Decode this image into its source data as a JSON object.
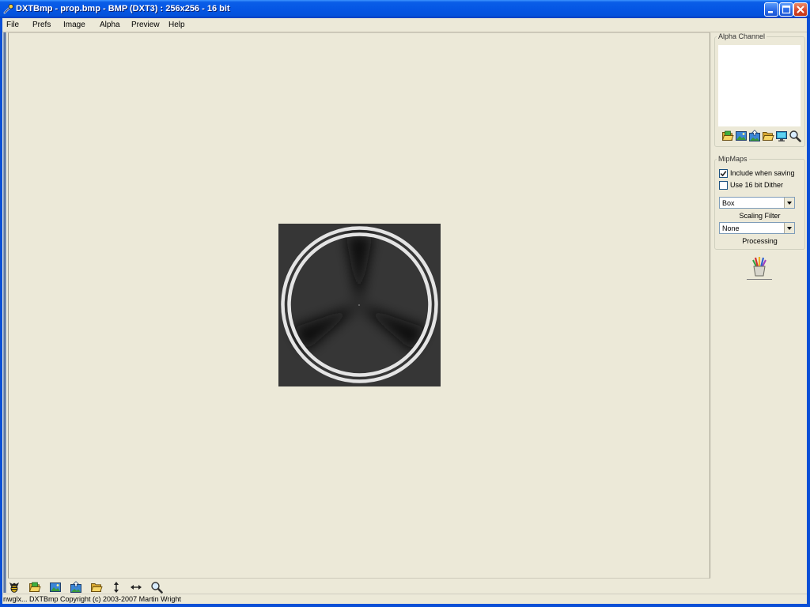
{
  "window": {
    "title": "DXTBmp - prop.bmp - BMP (DXT3) : 256x256 - 16 bit",
    "app_icon": "dxtbmp-app-icon",
    "controls": [
      "minimize-icon",
      "maximize-icon",
      "close-icon"
    ]
  },
  "menu": {
    "items": [
      "File",
      "Prefs",
      "Image",
      "Alpha",
      "Preview",
      "Help"
    ]
  },
  "alpha_channel": {
    "title": "Alpha Channel",
    "tools": [
      "open-folder-icon",
      "image-icon",
      "save-image-icon",
      "folder-icon",
      "display-icon",
      "zoom-icon"
    ]
  },
  "mipmaps": {
    "title": "MipMaps",
    "include_when_saving": {
      "label": "Include when saving",
      "checked": true
    },
    "use_dither": {
      "label": "Use 16 bit Dither",
      "checked": false
    },
    "scaling_filter": {
      "value": "Box",
      "label": "Scaling Filter"
    },
    "processing": {
      "value": "None",
      "label": "Processing"
    }
  },
  "processing_tool": {
    "icon": "brushes-icon"
  },
  "bottom_toolbar": {
    "tools": [
      "bug-icon",
      "open-folder-icon",
      "image-icon",
      "save-image-icon",
      "folder-icon",
      "flip-vertical-icon",
      "flip-horizontal-icon",
      "zoom-icon"
    ]
  },
  "status_bar": {
    "text": "nwglx... DXTBmp Copyright (c) 2003-2007 Martin Wright"
  },
  "colors": {
    "title_bar": "#0054E3",
    "window_background": "#ECE9D8",
    "close_button": "#D5452A",
    "texture_background": "#363636",
    "texture_blades": "#0c0c0c",
    "texture_rings": "#E4E4E4",
    "alpha_preview": "#FFFFFF"
  }
}
